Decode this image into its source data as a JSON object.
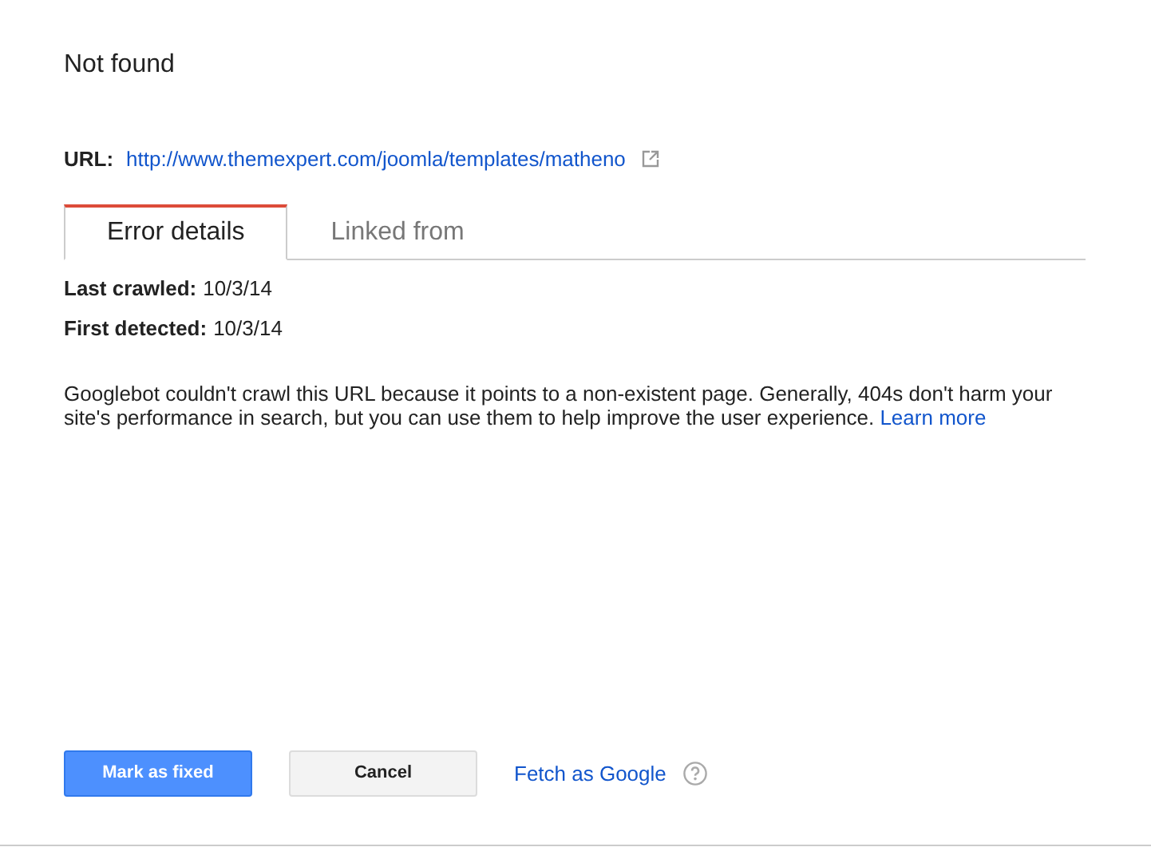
{
  "title": "Not found",
  "url": {
    "label": "URL:",
    "value": "http://www.themexpert.com/joomla/templates/matheno"
  },
  "tabs": [
    {
      "label": "Error details",
      "selected": true
    },
    {
      "label": "Linked from",
      "selected": false
    }
  ],
  "details": [
    {
      "label": "Last crawled:",
      "value": "10/3/14"
    },
    {
      "label": "First detected:",
      "value": "10/3/14"
    }
  ],
  "description": {
    "text": "Googlebot couldn't crawl this URL because it points to a non-existent page. Generally, 404s don't harm your site's performance in search, but you can use them to help improve the user experience.",
    "link": "Learn more"
  },
  "buttons": [
    {
      "label": "Mark as fixed",
      "kind": "primary"
    },
    {
      "label": "Cancel",
      "kind": "secondary"
    }
  ],
  "fetch_link": "Fetch as Google"
}
